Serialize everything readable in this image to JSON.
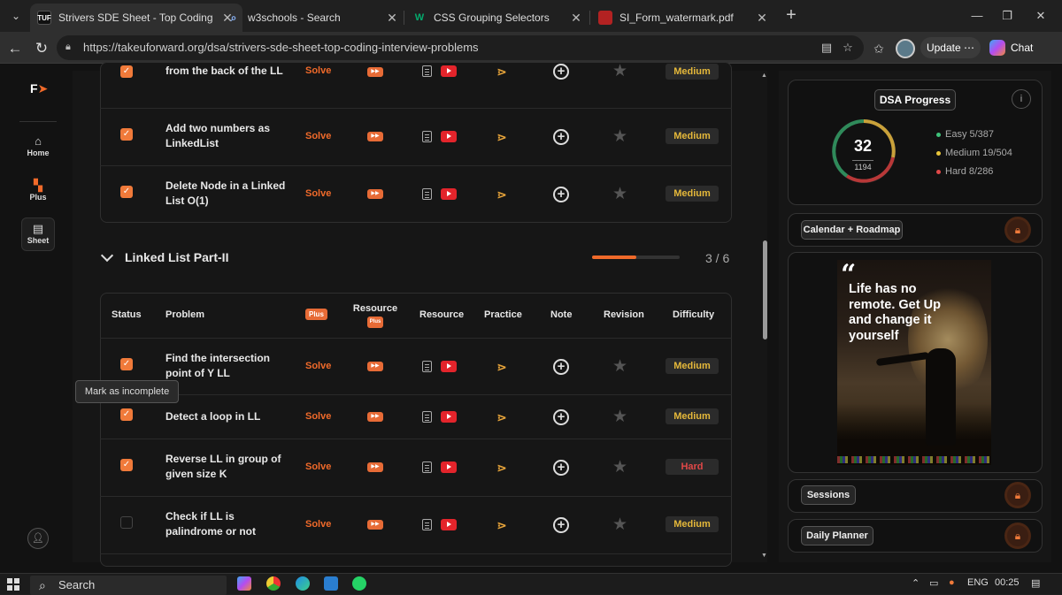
{
  "browser": {
    "tabs": [
      {
        "title": "Strivers SDE Sheet - Top Coding In",
        "favicon": "TUF",
        "active": true
      },
      {
        "title": "w3schools - Search",
        "favicon": "search-icon",
        "active": false
      },
      {
        "title": "CSS Grouping Selectors",
        "favicon": "W",
        "active": false
      },
      {
        "title": "SI_Form_watermark.pdf",
        "favicon": "pdf-icon",
        "active": false
      }
    ],
    "url": "https://takeuforward.org/dsa/strivers-sde-sheet-top-coding-interview-problems",
    "update_label": "Update",
    "chat_label": "Chat"
  },
  "sidebar": {
    "items": [
      {
        "label": "Home",
        "icon": "home-icon"
      },
      {
        "label": "Plus",
        "icon": "plus-grid-icon"
      },
      {
        "label": "Sheet",
        "icon": "sheet-icon",
        "active": true
      }
    ]
  },
  "prev_section": {
    "rows": [
      {
        "problem": "from the back of the LL",
        "solve": "Solve",
        "difficulty": "Medium",
        "checked": true
      },
      {
        "problem": "Add two numbers as LinkedList",
        "solve": "Solve",
        "difficulty": "Medium",
        "checked": true
      },
      {
        "problem": "Delete Node in a Linked List O(1)",
        "solve": "Solve",
        "difficulty": "Medium",
        "checked": true
      }
    ]
  },
  "section": {
    "title": "Linked List Part-II",
    "progress_text": "3 / 6",
    "progress_fraction": 0.5,
    "headers": {
      "status": "Status",
      "problem": "Problem",
      "plus": "Plus",
      "resource_plus": "Resource",
      "resource_plus_badge": "Plus",
      "resource": "Resource",
      "practice": "Practice",
      "note": "Note",
      "revision": "Revision",
      "difficulty": "Difficulty"
    },
    "rows": [
      {
        "problem": "Find the intersection point of Y LL",
        "solve": "Solve",
        "difficulty": "Medium",
        "checked": true
      },
      {
        "problem": "Detect a loop in LL",
        "solve": "Solve",
        "difficulty": "Medium",
        "checked": true
      },
      {
        "problem": "Reverse LL in group of given size K",
        "solve": "Solve",
        "difficulty": "Hard",
        "checked": true
      },
      {
        "problem": "Check if LL is palindrome or not",
        "solve": "Solve",
        "difficulty": "Medium",
        "checked": false
      }
    ]
  },
  "tooltip": "Mark as incomplete",
  "progress_card": {
    "title": "DSA Progress",
    "info": "i",
    "solved": "32",
    "total": "1194",
    "stats": [
      {
        "label": "Easy 5/387",
        "color": "#3ec27a"
      },
      {
        "label": "Medium 19/504",
        "color": "#e8c53a"
      },
      {
        "label": "Hard 8/286",
        "color": "#e04848"
      }
    ]
  },
  "calendar_label": "Calendar + Roadmap",
  "quote": {
    "mark": "“",
    "text": "Life has no remote. Get Up and change it yourself"
  },
  "sessions_label": "Sessions",
  "planner_label": "Daily Planner",
  "taskbar": {
    "search": "Search",
    "lang": "ENG",
    "time": "00:25"
  }
}
